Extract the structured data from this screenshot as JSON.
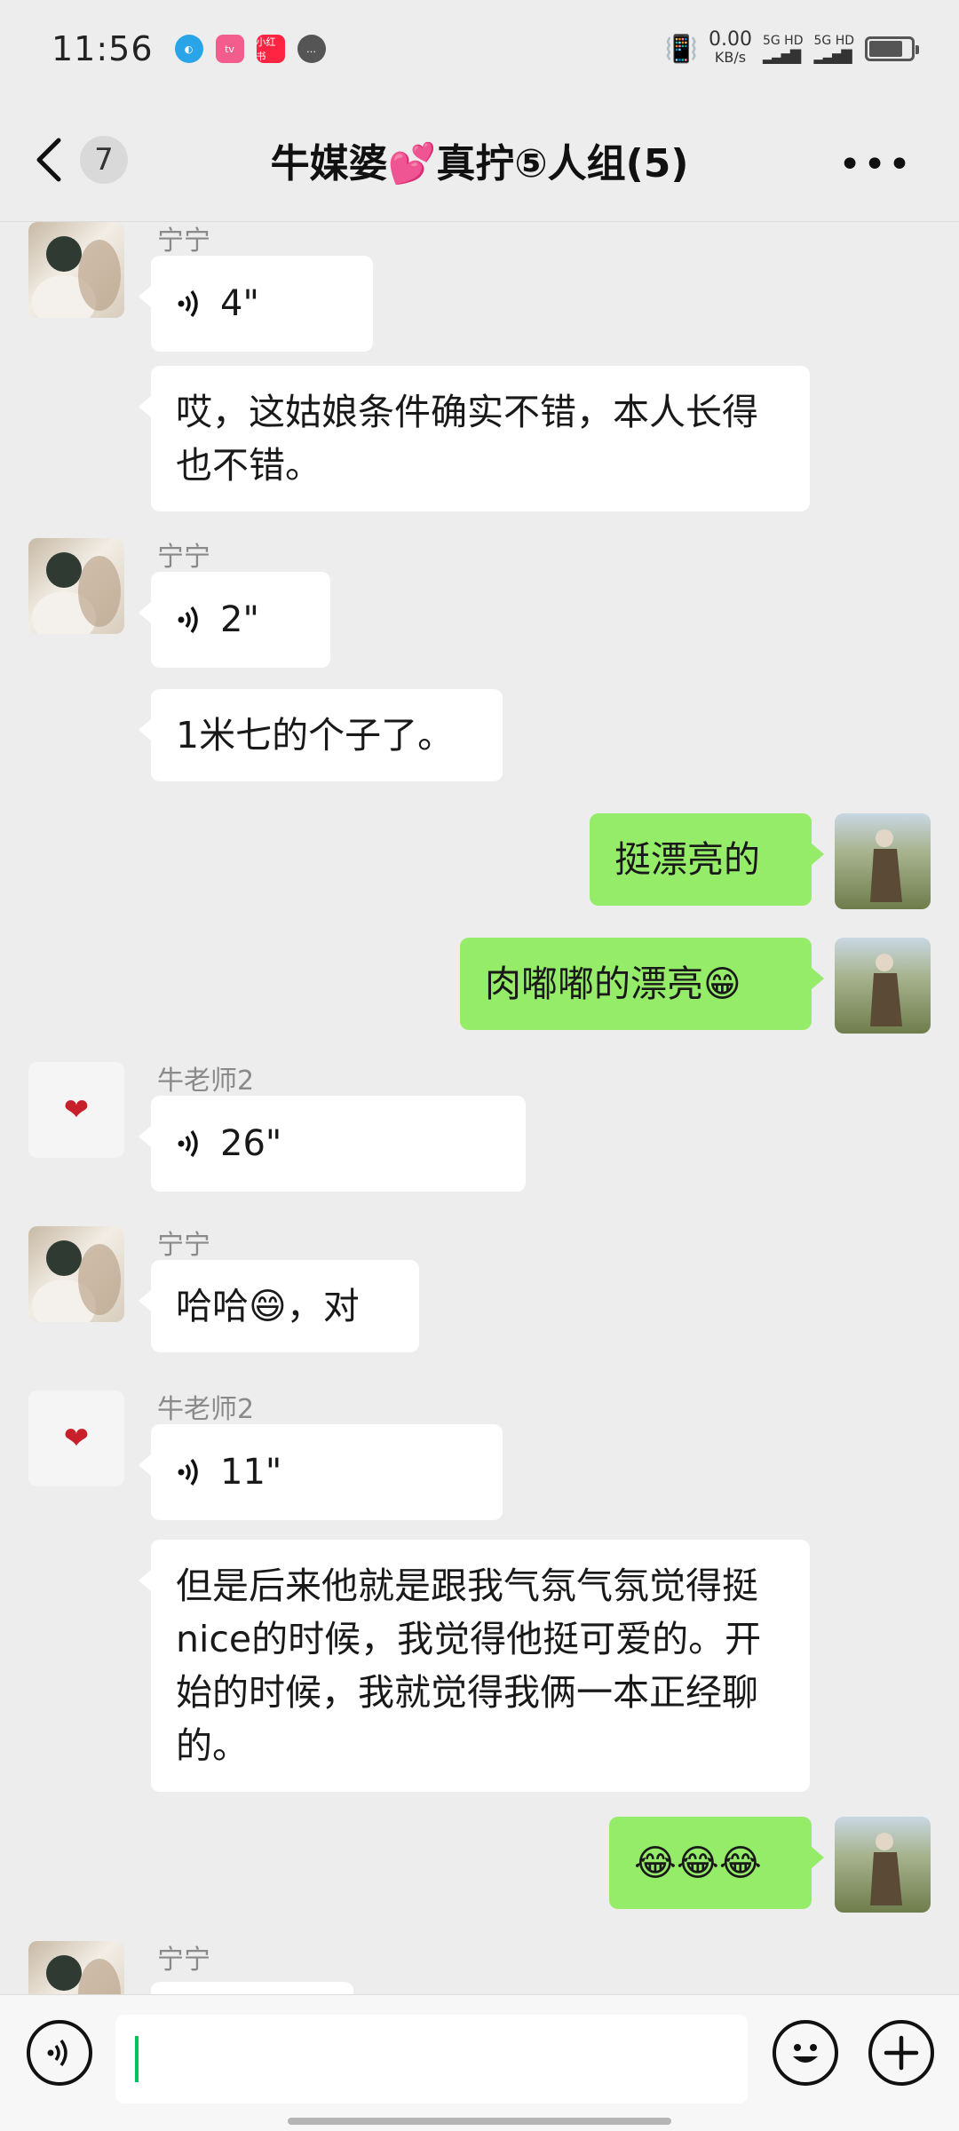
{
  "status_bar": {
    "time": "11:56",
    "apps": [
      "browser",
      "bilibili",
      "小红书",
      "message"
    ],
    "speed_value": "0.00",
    "speed_unit": "KB/s",
    "sim1": "5G HD",
    "sim2": "5G HD",
    "battery_level": 0.8
  },
  "header": {
    "unread_count": "7",
    "title": "牛媒婆💕真拧⑤人组(5)",
    "more_label": "•••"
  },
  "messages": [
    {
      "id": "m1",
      "side": "in",
      "sender": "宁宁",
      "avatar": "ningning",
      "type": "voice",
      "duration": "4\""
    },
    {
      "id": "m2",
      "side": "in",
      "type": "text",
      "text": "哎，这姑娘条件确实不错，本人长得也不错。"
    },
    {
      "id": "m3",
      "side": "in",
      "sender": "宁宁",
      "avatar": "ningning",
      "type": "voice",
      "duration": "2\""
    },
    {
      "id": "m4",
      "side": "in",
      "type": "text",
      "text": "1米七的个子了。"
    },
    {
      "id": "m5",
      "side": "out",
      "avatar": "me",
      "type": "text",
      "text": "挺漂亮的"
    },
    {
      "id": "m6",
      "side": "out",
      "avatar": "me",
      "type": "text",
      "text": "肉嘟嘟的漂亮😁"
    },
    {
      "id": "m7",
      "side": "in",
      "sender": "牛老师2",
      "avatar": "heart",
      "type": "voice",
      "duration": "26\""
    },
    {
      "id": "m8",
      "side": "in",
      "sender": "宁宁",
      "avatar": "ningning",
      "type": "text",
      "text": "哈哈😄，对"
    },
    {
      "id": "m9",
      "side": "in",
      "sender": "牛老师2",
      "avatar": "heart",
      "type": "voice",
      "duration": "11\""
    },
    {
      "id": "m10",
      "side": "in",
      "type": "text",
      "text": "但是后来他就是跟我气氛气氛觉得挺nice的时候，我觉得他挺可爱的。开始的时候，我就觉得我俩一本正经聊的。"
    },
    {
      "id": "m11",
      "side": "out",
      "avatar": "me",
      "type": "text",
      "text": "😂😂😂"
    },
    {
      "id": "m12",
      "side": "in",
      "sender": "宁宁",
      "avatar": "ningning",
      "type": "partial"
    }
  ],
  "input_bar": {
    "voice_button": "voice-mode",
    "text_value": "",
    "emoji_button": "emoji",
    "plus_button": "more-functions"
  },
  "colors": {
    "background": "#ededed",
    "incoming_bubble": "#ffffff",
    "outgoing_bubble": "#95ec69",
    "caret": "#07c160"
  }
}
